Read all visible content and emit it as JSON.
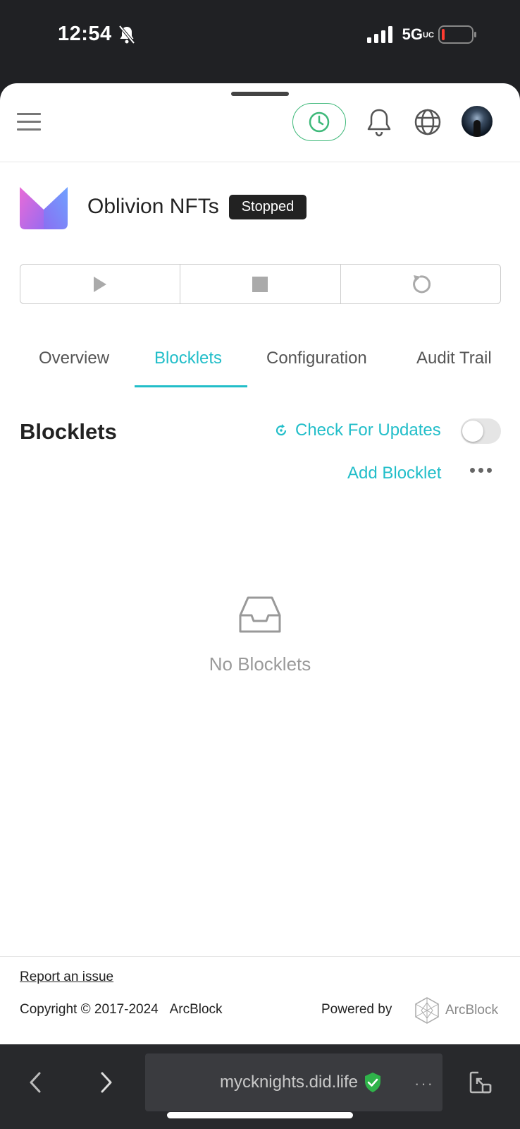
{
  "status_bar": {
    "time": "12:54",
    "network": "5G",
    "network_sub": "UC"
  },
  "app": {
    "name": "Oblivion NFTs",
    "status": "Stopped"
  },
  "tabs": [
    {
      "label": "Overview"
    },
    {
      "label": "Blocklets"
    },
    {
      "label": "Configuration"
    },
    {
      "label": "Audit Trail"
    }
  ],
  "section": {
    "title": "Blocklets",
    "check_updates": "Check For Updates",
    "add_blocklet": "Add Blocklet",
    "empty_text": "No Blocklets"
  },
  "footer": {
    "report": "Report an issue",
    "copyright": "Copyright © 2017-2024",
    "company": "ArcBlock",
    "powered_by": "Powered by",
    "brand": "ArcBlock"
  },
  "browser": {
    "url": "mycknights.did.life",
    "more": "···"
  },
  "colors": {
    "accent": "#22bec9",
    "clock_green": "#3fb97a",
    "badge_bg": "#222222"
  }
}
